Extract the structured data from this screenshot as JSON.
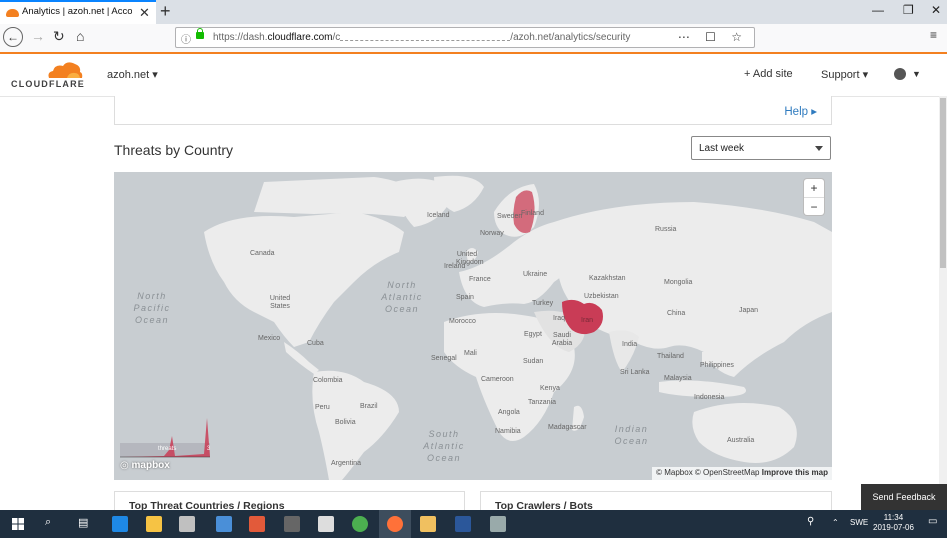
{
  "browser": {
    "tab_title": "Analytics | azoh.net | Account",
    "url_prefix": "https://dash.",
    "url_domain": "cloudflare.com",
    "url_sep": "/c",
    "url_suffix": "/azoh.net/analytics/security"
  },
  "header": {
    "logo_text": "CLOUDFLARE",
    "domain": "azoh.net",
    "add_site": "+ Add site",
    "support": "Support"
  },
  "help": {
    "label": "Help"
  },
  "threats": {
    "title": "Threats by Country",
    "period": "Last week"
  },
  "map": {
    "countries": [
      "Canada",
      "United States",
      "Mexico",
      "Cuba",
      "Colombia",
      "Peru",
      "Brazil",
      "Bolivia",
      "Argentina",
      "Sweden",
      "Finland",
      "Norway",
      "Iceland",
      "United Kingdom",
      "Ireland",
      "France",
      "Spain",
      "Ukraine",
      "Kazakhstan",
      "Mongolia",
      "Russia",
      "China",
      "Japan",
      "India",
      "Turkey",
      "Iraq",
      "Iran",
      "Egypt",
      "Saudi Arabia",
      "Morocco",
      "Mali",
      "Senegal",
      "Sudan",
      "Cameroon",
      "Kenya",
      "Tanzania",
      "Angola",
      "Namibia",
      "Madagascar",
      "Thailand",
      "Philippines",
      "Sri Lanka",
      "Malaysia",
      "Indonesia",
      "Australia",
      "Uzbekistan"
    ],
    "oceans": {
      "north_pacific": "North Pacific Ocean",
      "north_atlantic": "North Atlantic Ocean",
      "south_atlantic": "South Atlantic Ocean",
      "indian": "Indian Ocean"
    },
    "highlighted_countries": [
      {
        "name": "Finland",
        "color": "#d36b7c"
      },
      {
        "name": "Iran",
        "color": "#c93c56"
      }
    ],
    "legend_label": "threats",
    "legend_max": "3",
    "logo": "mapbox",
    "attribution_1": "© Mapbox © OpenStreetMap",
    "attribution_2": "Improve this map",
    "zoom_in": "+",
    "zoom_out": "−"
  },
  "cards_below": {
    "left_title": "Top Threat Countries / Regions",
    "right_title": "Top Crawlers / Bots"
  },
  "feedback": "Send Feedback",
  "taskbar": {
    "language": "SWE",
    "time": "11:34",
    "date": "2019-07-06"
  },
  "colors": {
    "brand_orange": "#f38020",
    "link_blue": "#2f7bbf",
    "threat_high": "#c93c56",
    "threat_low": "#d36b7c"
  }
}
